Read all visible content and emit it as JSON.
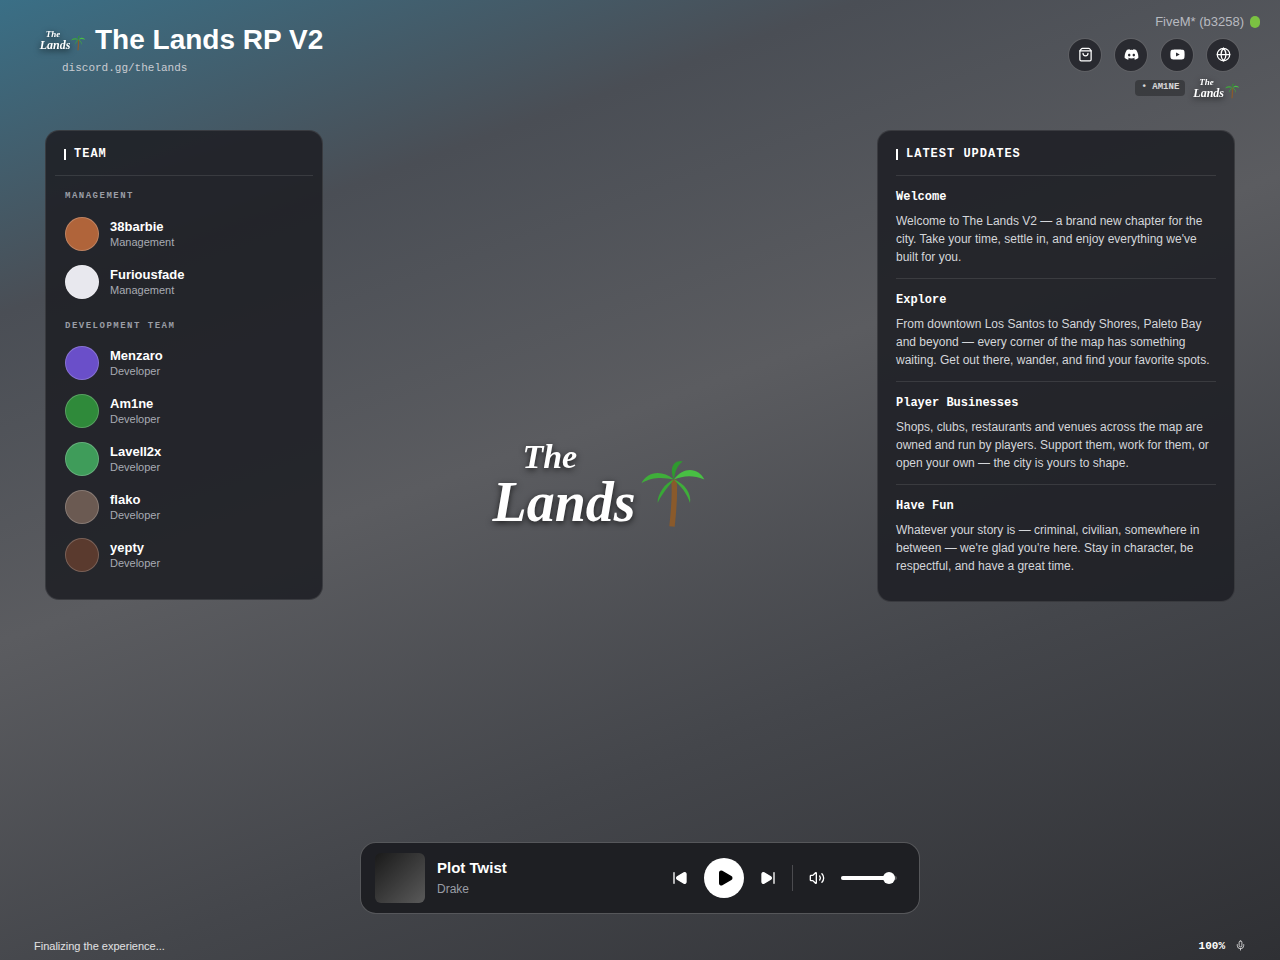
{
  "header": {
    "title": "The Lands RP V2",
    "subtitle": "discord.gg/thelands",
    "logo": {
      "top": "The",
      "bottom": "Lands"
    }
  },
  "top_right": {
    "build": "FiveM* (b3258)",
    "badge": "AM1NE",
    "watermark": {
      "top": "The",
      "bottom": "Lands"
    }
  },
  "team": {
    "title": "TEAM",
    "groups": [
      {
        "title": "MANAGEMENT",
        "members": [
          {
            "name": "38barbie",
            "role": "Management",
            "color": "#b0643a"
          },
          {
            "name": "Furiousfade",
            "role": "Management",
            "color": "#e8e8ee"
          }
        ]
      },
      {
        "title": "DEVELOPMENT TEAM",
        "members": [
          {
            "name": "Menzaro",
            "role": "Developer",
            "color": "#6a4fc9"
          },
          {
            "name": "Am1ne",
            "role": "Developer",
            "color": "#2f8a3a"
          },
          {
            "name": "Lavell2x",
            "role": "Developer",
            "color": "#3f9c5a"
          },
          {
            "name": "flako",
            "role": "Developer",
            "color": "#6b5a52"
          },
          {
            "name": "yepty",
            "role": "Developer",
            "color": "#5a3a2e"
          }
        ]
      }
    ]
  },
  "updates": {
    "title": "LATEST UPDATES",
    "items": [
      {
        "title": "Welcome",
        "body": "Welcome to The Lands V2 — a brand new chapter for the city. Take your time, settle in, and enjoy everything we've built for you."
      },
      {
        "title": "Explore",
        "body": "From downtown Los Santos to Sandy Shores, Paleto Bay and beyond — every corner of the map has something waiting. Get out there, wander, and find your favorite spots."
      },
      {
        "title": "Player Businesses",
        "body": "Shops, clubs, restaurants and venues across the map are owned and run by players. Support them, work for them, or open your own — the city is yours to shape."
      },
      {
        "title": "Have Fun",
        "body": "Whatever your story is — criminal, civilian, somewhere in between — we're glad you're here. Stay in character, be respectful, and have a great time."
      }
    ]
  },
  "center_logo": {
    "top": "The",
    "bottom": "Lands"
  },
  "player": {
    "track": "Plot Twist",
    "artist": "Drake",
    "playing": false,
    "volume": 0.85
  },
  "status": {
    "message": "Finalizing the experience...",
    "progress": "100%"
  }
}
